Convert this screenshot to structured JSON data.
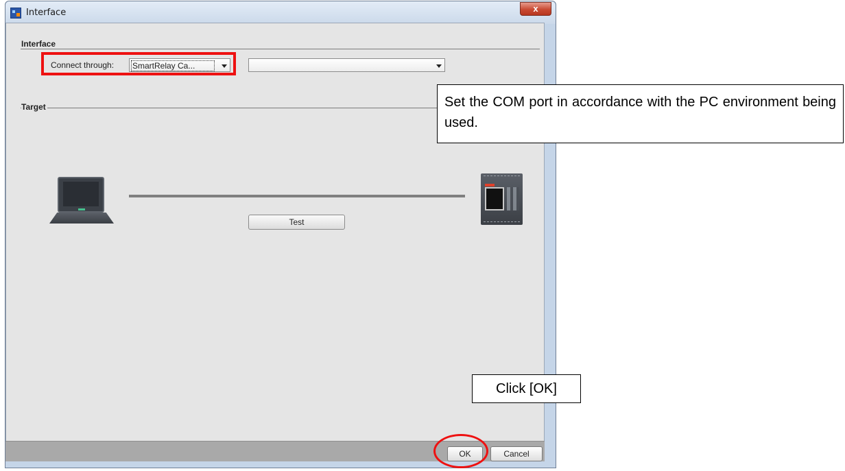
{
  "window": {
    "title": "Interface",
    "close_glyph": "x"
  },
  "interface_group": {
    "label": "Interface",
    "connect_label": "Connect through:",
    "connect_value": "SmartRelay Ca...",
    "port_value": ""
  },
  "target_group": {
    "label": "Target",
    "test_button": "Test"
  },
  "buttons": {
    "ok": "OK",
    "cancel": "Cancel"
  },
  "annotations": {
    "com_port_note": "Set the COM port in accordance with the PC environment being used.",
    "ok_note": "Click [OK]"
  },
  "colors": {
    "highlight": "#ee1111",
    "client_bg": "#e5e5e5"
  },
  "icons": {
    "app": "app-icon",
    "pc": "laptop-icon",
    "device": "smart-relay-icon"
  }
}
